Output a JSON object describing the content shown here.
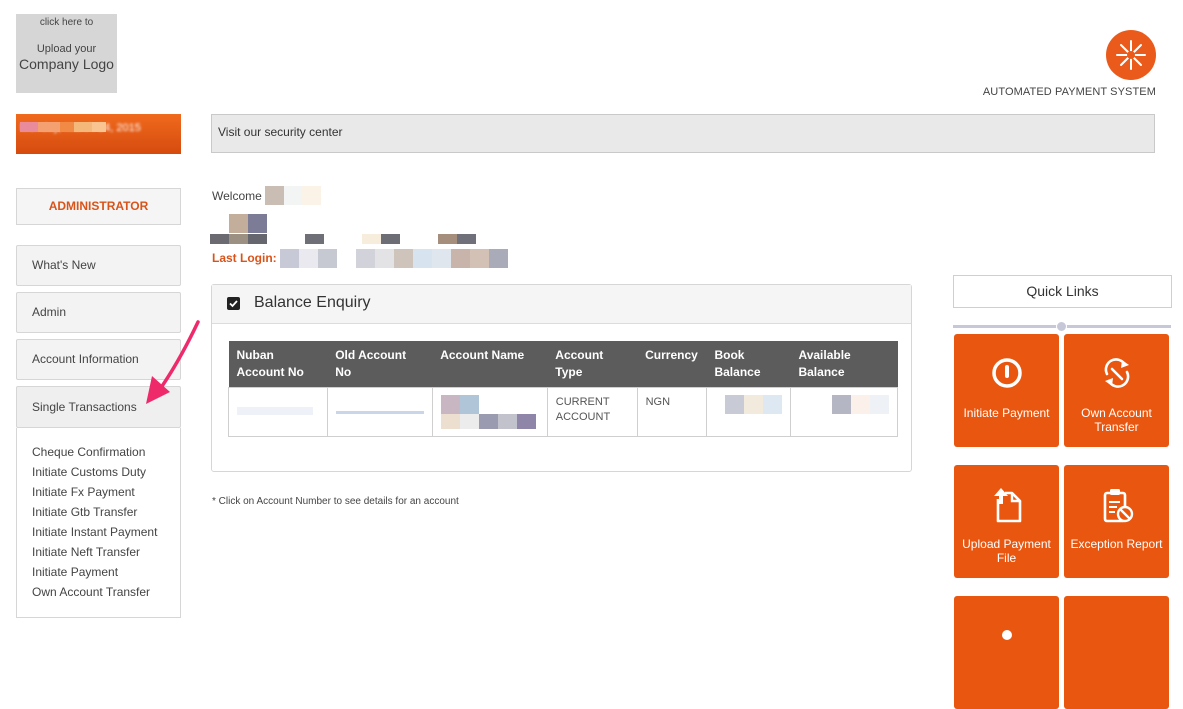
{
  "logo": {
    "line1": "click here to",
    "line2": "Upload your",
    "line3": "Company Logo"
  },
  "brand": {
    "tagline": "AUTOMATED PAYMENT SYSTEM",
    "color": "#ea5b1b"
  },
  "date_bar": {
    "text": "Monday, March 24, 2015"
  },
  "security": {
    "text": "Visit our security center"
  },
  "sidebar": {
    "role": "ADMINISTRATOR",
    "items": [
      {
        "label": "What's New"
      },
      {
        "label": "Admin"
      },
      {
        "label": "Account Information"
      },
      {
        "label": "Single Transactions"
      }
    ],
    "submenu": [
      "Cheque Confirmation",
      "Initiate Customs Duty",
      "Initiate Fx Payment",
      "Initiate Gtb Transfer",
      "Initiate Instant Payment",
      "Initiate Neft Transfer",
      "Initiate Payment",
      "Own Account Transfer"
    ]
  },
  "welcome": {
    "prefix": "Welcome",
    "last_login_label": "Last Login:"
  },
  "balance": {
    "title": "Balance Enquiry",
    "columns": [
      "Nuban Account No",
      "Old Account No",
      "Account Name",
      "Account Type",
      "Currency",
      "Book Balance",
      "Available Balance"
    ],
    "rows": [
      {
        "account_type": "CURRENT ACCOUNT",
        "currency": "NGN"
      }
    ]
  },
  "footnote": "* Click on Account Number to see details for an account",
  "quick_links": {
    "title": "Quick Links",
    "tiles": [
      {
        "label": "Initiate Payment",
        "icon": "power-icon"
      },
      {
        "label": "Own Account Transfer",
        "icon": "transfer-arrows-icon"
      },
      {
        "label": "Upload Payment File",
        "icon": "upload-file-icon"
      },
      {
        "label": "Exception Report",
        "icon": "clipboard-block-icon"
      }
    ]
  },
  "colors": {
    "accent": "#e8560f",
    "header": "#5c5c5c",
    "arrow": "#ee2a6b"
  }
}
